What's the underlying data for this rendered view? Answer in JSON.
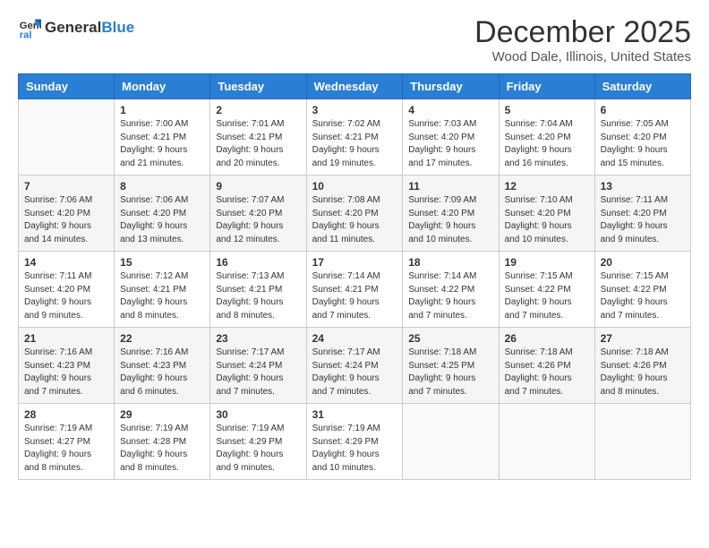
{
  "logo": {
    "general": "General",
    "blue": "Blue"
  },
  "header": {
    "month": "December 2025",
    "location": "Wood Dale, Illinois, United States"
  },
  "weekdays": [
    "Sunday",
    "Monday",
    "Tuesday",
    "Wednesday",
    "Thursday",
    "Friday",
    "Saturday"
  ],
  "weeks": [
    [
      {
        "day": "",
        "info": ""
      },
      {
        "day": "1",
        "info": "Sunrise: 7:00 AM\nSunset: 4:21 PM\nDaylight: 9 hours\nand 21 minutes."
      },
      {
        "day": "2",
        "info": "Sunrise: 7:01 AM\nSunset: 4:21 PM\nDaylight: 9 hours\nand 20 minutes."
      },
      {
        "day": "3",
        "info": "Sunrise: 7:02 AM\nSunset: 4:21 PM\nDaylight: 9 hours\nand 19 minutes."
      },
      {
        "day": "4",
        "info": "Sunrise: 7:03 AM\nSunset: 4:20 PM\nDaylight: 9 hours\nand 17 minutes."
      },
      {
        "day": "5",
        "info": "Sunrise: 7:04 AM\nSunset: 4:20 PM\nDaylight: 9 hours\nand 16 minutes."
      },
      {
        "day": "6",
        "info": "Sunrise: 7:05 AM\nSunset: 4:20 PM\nDaylight: 9 hours\nand 15 minutes."
      }
    ],
    [
      {
        "day": "7",
        "info": "Sunrise: 7:06 AM\nSunset: 4:20 PM\nDaylight: 9 hours\nand 14 minutes."
      },
      {
        "day": "8",
        "info": "Sunrise: 7:06 AM\nSunset: 4:20 PM\nDaylight: 9 hours\nand 13 minutes."
      },
      {
        "day": "9",
        "info": "Sunrise: 7:07 AM\nSunset: 4:20 PM\nDaylight: 9 hours\nand 12 minutes."
      },
      {
        "day": "10",
        "info": "Sunrise: 7:08 AM\nSunset: 4:20 PM\nDaylight: 9 hours\nand 11 minutes."
      },
      {
        "day": "11",
        "info": "Sunrise: 7:09 AM\nSunset: 4:20 PM\nDaylight: 9 hours\nand 10 minutes."
      },
      {
        "day": "12",
        "info": "Sunrise: 7:10 AM\nSunset: 4:20 PM\nDaylight: 9 hours\nand 10 minutes."
      },
      {
        "day": "13",
        "info": "Sunrise: 7:11 AM\nSunset: 4:20 PM\nDaylight: 9 hours\nand 9 minutes."
      }
    ],
    [
      {
        "day": "14",
        "info": "Sunrise: 7:11 AM\nSunset: 4:20 PM\nDaylight: 9 hours\nand 9 minutes."
      },
      {
        "day": "15",
        "info": "Sunrise: 7:12 AM\nSunset: 4:21 PM\nDaylight: 9 hours\nand 8 minutes."
      },
      {
        "day": "16",
        "info": "Sunrise: 7:13 AM\nSunset: 4:21 PM\nDaylight: 9 hours\nand 8 minutes."
      },
      {
        "day": "17",
        "info": "Sunrise: 7:14 AM\nSunset: 4:21 PM\nDaylight: 9 hours\nand 7 minutes."
      },
      {
        "day": "18",
        "info": "Sunrise: 7:14 AM\nSunset: 4:22 PM\nDaylight: 9 hours\nand 7 minutes."
      },
      {
        "day": "19",
        "info": "Sunrise: 7:15 AM\nSunset: 4:22 PM\nDaylight: 9 hours\nand 7 minutes."
      },
      {
        "day": "20",
        "info": "Sunrise: 7:15 AM\nSunset: 4:22 PM\nDaylight: 9 hours\nand 7 minutes."
      }
    ],
    [
      {
        "day": "21",
        "info": "Sunrise: 7:16 AM\nSunset: 4:23 PM\nDaylight: 9 hours\nand 7 minutes."
      },
      {
        "day": "22",
        "info": "Sunrise: 7:16 AM\nSunset: 4:23 PM\nDaylight: 9 hours\nand 6 minutes."
      },
      {
        "day": "23",
        "info": "Sunrise: 7:17 AM\nSunset: 4:24 PM\nDaylight: 9 hours\nand 7 minutes."
      },
      {
        "day": "24",
        "info": "Sunrise: 7:17 AM\nSunset: 4:24 PM\nDaylight: 9 hours\nand 7 minutes."
      },
      {
        "day": "25",
        "info": "Sunrise: 7:18 AM\nSunset: 4:25 PM\nDaylight: 9 hours\nand 7 minutes."
      },
      {
        "day": "26",
        "info": "Sunrise: 7:18 AM\nSunset: 4:26 PM\nDaylight: 9 hours\nand 7 minutes."
      },
      {
        "day": "27",
        "info": "Sunrise: 7:18 AM\nSunset: 4:26 PM\nDaylight: 9 hours\nand 8 minutes."
      }
    ],
    [
      {
        "day": "28",
        "info": "Sunrise: 7:19 AM\nSunset: 4:27 PM\nDaylight: 9 hours\nand 8 minutes."
      },
      {
        "day": "29",
        "info": "Sunrise: 7:19 AM\nSunset: 4:28 PM\nDaylight: 9 hours\nand 8 minutes."
      },
      {
        "day": "30",
        "info": "Sunrise: 7:19 AM\nSunset: 4:29 PM\nDaylight: 9 hours\nand 9 minutes."
      },
      {
        "day": "31",
        "info": "Sunrise: 7:19 AM\nSunset: 4:29 PM\nDaylight: 9 hours\nand 10 minutes."
      },
      {
        "day": "",
        "info": ""
      },
      {
        "day": "",
        "info": ""
      },
      {
        "day": "",
        "info": ""
      }
    ]
  ]
}
